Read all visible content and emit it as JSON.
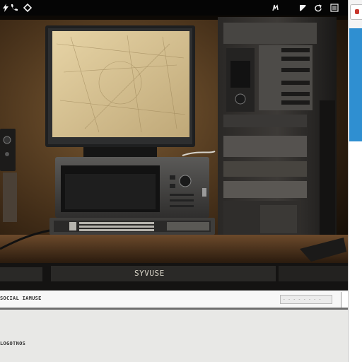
{
  "toolbar": {
    "buttons": [
      {
        "name": "flash-icon",
        "glyph": "ϟ"
      },
      {
        "name": "phone-icon",
        "glyph": "✆"
      },
      {
        "name": "diamond-icon",
        "glyph": "◇"
      },
      {
        "name": "cursor-icon",
        "glyph": "⌖"
      },
      {
        "name": "arrow-icon",
        "glyph": "⬈"
      },
      {
        "name": "refresh-icon",
        "glyph": "↻"
      },
      {
        "name": "menu-icon",
        "glyph": "☰"
      }
    ]
  },
  "viewer": {
    "brand_text": "SYVUSE"
  },
  "status": {
    "label": "SOCIAL IAMUSE",
    "field_text": "- - - - - - - -"
  },
  "bottom": {
    "label": "LOGOTNOS"
  },
  "colors": {
    "toolbar_bg": "#050505",
    "accent_blue": "#2f8fd1",
    "accent_red": "#c8372d",
    "panel_bg": "#e8e8e6"
  }
}
